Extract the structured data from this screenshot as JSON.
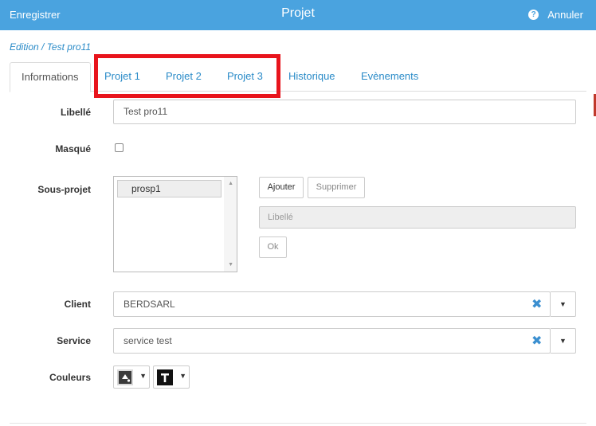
{
  "header": {
    "save_label": "Enregistrer",
    "title": "Projet",
    "cancel_label": "Annuler"
  },
  "breadcrumb": "Edition / Test pro11",
  "tabs": [
    {
      "label": "Informations"
    },
    {
      "label": "Projet 1"
    },
    {
      "label": "Projet 2"
    },
    {
      "label": "Projet 3"
    },
    {
      "label": "Historique"
    },
    {
      "label": "Evènements"
    }
  ],
  "form": {
    "libelle": {
      "label": "Libellé",
      "value": "Test pro11"
    },
    "masque": {
      "label": "Masqué",
      "checked": false
    },
    "sous_projet": {
      "label": "Sous-projet",
      "items": [
        "prosp1"
      ],
      "add_label": "Ajouter",
      "delete_label": "Supprimer",
      "libelle_placeholder": "Libellé",
      "ok_label": "Ok"
    },
    "client": {
      "label": "Client",
      "value": "BERDSARL"
    },
    "service": {
      "label": "Service",
      "value": "service test"
    },
    "couleurs": {
      "label": "Couleurs",
      "background_icon": "paint-bucket-icon",
      "text_icon": "text-color-icon"
    }
  },
  "colors": {
    "header": "#4aa3df",
    "link": "#2a8bc8",
    "highlight": "#e8141c",
    "clear_icon": "#3b8fd0"
  }
}
